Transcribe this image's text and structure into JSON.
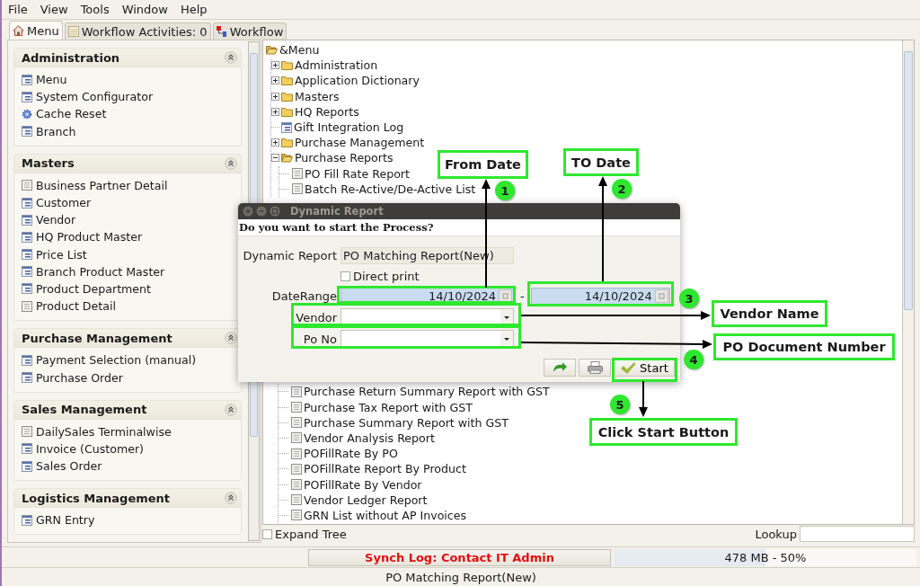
{
  "menu_bar": [
    {
      "label": "File"
    },
    {
      "label": "View"
    },
    {
      "label": "Tools"
    },
    {
      "label": "Window"
    },
    {
      "label": "Help"
    }
  ],
  "tabs": [
    {
      "label": "Menu",
      "kind": "home",
      "selected": true
    },
    {
      "label": "Workflow Activities: 0",
      "kind": "list",
      "selected": false
    },
    {
      "label": "Workflow",
      "kind": "workflow",
      "selected": false
    }
  ],
  "sidebar": {
    "sections": [
      {
        "title": "Administration",
        "expanded": true,
        "items": [
          {
            "label": "Menu",
            "kind": "window"
          },
          {
            "label": "System Configurator",
            "kind": "window"
          },
          {
            "label": "Cache Reset",
            "kind": "process"
          },
          {
            "label": "Branch",
            "kind": "window"
          }
        ]
      },
      {
        "title": "Masters",
        "expanded": true,
        "items": [
          {
            "label": "Business Partner Detail",
            "kind": "report"
          },
          {
            "label": "Customer",
            "kind": "window"
          },
          {
            "label": "Vendor",
            "kind": "window"
          },
          {
            "label": "HQ Product Master",
            "kind": "window"
          },
          {
            "label": "Price List",
            "kind": "window"
          },
          {
            "label": "Branch Product Master",
            "kind": "window"
          },
          {
            "label": "Product Department",
            "kind": "window"
          },
          {
            "label": "Product Detail",
            "kind": "report"
          }
        ]
      },
      {
        "title": "Purchase Management",
        "expanded": true,
        "items": [
          {
            "label": "Payment Selection (manual)",
            "kind": "window"
          },
          {
            "label": "Purchase Order",
            "kind": "window"
          }
        ]
      },
      {
        "title": "Sales Management",
        "expanded": true,
        "items": [
          {
            "label": "DailySales Terminalwise",
            "kind": "report"
          },
          {
            "label": "Invoice (Customer)",
            "kind": "window"
          },
          {
            "label": "Sales Order",
            "kind": "window"
          }
        ]
      },
      {
        "title": "Logistics Management",
        "expanded": true,
        "items": [
          {
            "label": "GRN Entry",
            "kind": "window"
          }
        ]
      }
    ]
  },
  "tree": {
    "root": "&Menu",
    "children": [
      {
        "label": "Administration",
        "kind": "folder",
        "expanded": false
      },
      {
        "label": "Application Dictionary",
        "kind": "folder",
        "expanded": false
      },
      {
        "label": "Masters",
        "kind": "folder",
        "expanded": false
      },
      {
        "label": "HQ Reports",
        "kind": "folder",
        "expanded": false
      },
      {
        "label": "Gift Integration Log",
        "kind": "window"
      },
      {
        "label": "Purchase Management",
        "kind": "folder",
        "expanded": false
      },
      {
        "label": "Purchase Reports",
        "kind": "folder",
        "expanded": true,
        "children": [
          {
            "label": "PO Fill Rate Report",
            "kind": "report"
          },
          {
            "label": "Batch Re-Active/De-Active List",
            "kind": "report"
          }
        ]
      }
    ]
  },
  "tree_continued": [
    {
      "label": "Purchase Return Summary Report with GST",
      "kind": "report"
    },
    {
      "label": "Purchase Tax Report with GST",
      "kind": "report"
    },
    {
      "label": "Purchase Summary Report with GST",
      "kind": "report"
    },
    {
      "label": "Vendor Analysis Report",
      "kind": "report"
    },
    {
      "label": "POFillRate By PO",
      "kind": "report"
    },
    {
      "label": "POFillRate Report By Product",
      "kind": "report"
    },
    {
      "label": "POFillRate By Vendor",
      "kind": "report"
    },
    {
      "label": "Vendor Ledger Report",
      "kind": "report"
    },
    {
      "label": "GRN List without AP Invoices",
      "kind": "report"
    }
  ],
  "expand_tree": {
    "label": "Expand Tree",
    "checked": false
  },
  "lookup": {
    "label": "Lookup"
  },
  "status_bar": {
    "sync_log": "Synch Log: Contact IT Admin",
    "memory": {
      "reading": "478 MB - 50%",
      "level": 0.5
    },
    "message": "PO Matching Report(New)"
  },
  "dialog": {
    "title": "Dynamic Report",
    "prompt": "Do you want to start the Process?",
    "report": {
      "label": "Dynamic Report",
      "value": "PO Matching Report(New)"
    },
    "direct_print": {
      "label": "Direct print",
      "checked": false
    },
    "date_range": {
      "label": "DateRange",
      "from": "14/10/2024",
      "separator": "-",
      "to": "14/10/2024"
    },
    "vendor": {
      "label": "Vendor"
    },
    "po_no": {
      "label": "Po No"
    },
    "start": "Start"
  },
  "annotations": {
    "callouts": [
      "From Date",
      "TO Date",
      "Vendor Name",
      "PO Document Number",
      "Click Start Button"
    ],
    "steps": [
      "1",
      "2",
      "3",
      "4",
      "5"
    ]
  }
}
